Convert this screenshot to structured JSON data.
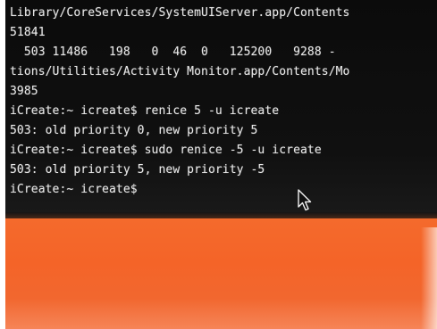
{
  "terminal": {
    "lines": [
      "Library/CoreServices/SystemUIServer.app/Contents",
      "51841",
      "  503 11486   198   0  46  0   125200   9288 -",
      "tions/Utilities/Activity Monitor.app/Contents/Mo",
      "3985",
      "iCreate:~ icreate$ renice 5 -u icreate",
      "503: old priority 0, new priority 5",
      "iCreate:~ icreate$ sudo renice -5 -u icreate",
      "503: old priority 5, new priority -5",
      "iCreate:~ icreate$"
    ]
  },
  "cursor": {
    "icon": "mouse-pointer-icon"
  },
  "colors": {
    "terminal_bg": "#0b0b0b",
    "terminal_text": "#e8e8e8",
    "desktop_orange": "#f46a2c"
  }
}
